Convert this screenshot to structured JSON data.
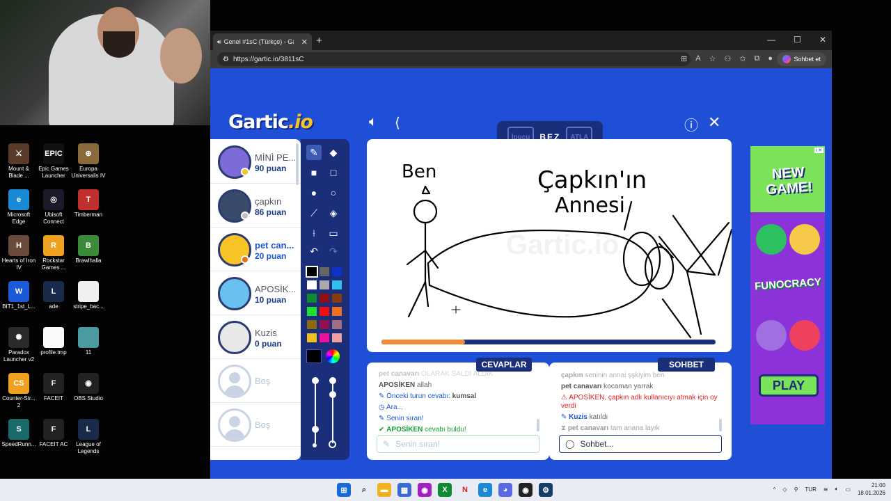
{
  "desktop_icons": [
    {
      "label": "Mount &\nBlade ...",
      "color": "#5a3a2a",
      "glyph": "⚔"
    },
    {
      "label": "Epic Games\nLauncher",
      "color": "#111",
      "glyph": "EPIC"
    },
    {
      "label": "Europa\nUniversalis IV",
      "color": "#8a6a3a",
      "glyph": "⊕"
    },
    {
      "label": "Microsoft\nEdge",
      "color": "#1a8ad6",
      "glyph": "e"
    },
    {
      "label": "Ubisoft\nConnect",
      "color": "#1a1a2a",
      "glyph": "◎"
    },
    {
      "label": "Timberman",
      "color": "#c03030",
      "glyph": "T"
    },
    {
      "label": "Hearts of Iron\nIV",
      "color": "#6a4a3a",
      "glyph": "H"
    },
    {
      "label": "Rockstar\nGames ...",
      "color": "#f0a020",
      "glyph": "R"
    },
    {
      "label": "Brawlhalla",
      "color": "#3a8a3a",
      "glyph": "B"
    },
    {
      "label": "BIT1_1st_L...",
      "color": "#1a5ad6",
      "glyph": "W"
    },
    {
      "label": "ade",
      "color": "#1a2a4a",
      "glyph": "L"
    },
    {
      "label": "stripe_bac...",
      "color": "#f0f0f0",
      "glyph": ""
    },
    {
      "label": "Paradox\nLauncher v2",
      "color": "#2a2a2a",
      "glyph": "✺"
    },
    {
      "label": "profile.tmp",
      "color": "#fafafa",
      "glyph": ""
    },
    {
      "label": "11",
      "color": "#4a9aa0",
      "glyph": ""
    },
    {
      "label": "Counter-Str...\n2",
      "color": "#f0a020",
      "glyph": "CS"
    },
    {
      "label": "FACEIT",
      "color": "#222",
      "glyph": "F"
    },
    {
      "label": "OBS Studio",
      "color": "#222",
      "glyph": "◉"
    },
    {
      "label": "SpeedRunn...",
      "color": "#1a6a6a",
      "glyph": "S"
    },
    {
      "label": "FACEIT AC",
      "color": "#222",
      "glyph": "F"
    },
    {
      "label": "League of\nLegends",
      "color": "#1a2a4a",
      "glyph": "L"
    }
  ],
  "browser": {
    "tab_title": "Genel #1sC (Türkçe) - Gartic.io",
    "url": "https://gartic.io/3811sC",
    "chat_button": "Sohbet et"
  },
  "game": {
    "logo_main": "Gartic",
    "logo_io": ".io",
    "hint_label": "İpucu",
    "word_label": "BEZ",
    "skip_label": "ATLA",
    "players": [
      {
        "name": "MİNİ PE...",
        "points": "90 puan",
        "avatar_color": "#7b6cd9",
        "dot": "#f7c325",
        "mark": "",
        "highlight": false
      },
      {
        "name": "çapkın",
        "points": "86 puan",
        "avatar_color": "#3a4a6a",
        "dot": "#c0c0c0",
        "mark": "",
        "highlight": false
      },
      {
        "name": "pet can...",
        "points": "20 puan",
        "avatar_color": "#f7c325",
        "dot": "#e07020",
        "mark": "✎",
        "highlight": true
      },
      {
        "name": "APOSİK...",
        "points": "10 puan",
        "avatar_color": "#6ac0f0",
        "dot": "",
        "mark": "✔",
        "highlight": false
      },
      {
        "name": "Kuzis",
        "points": "0 puan",
        "avatar_color": "#e8e8e8",
        "dot": "",
        "mark": "",
        "highlight": false
      },
      {
        "name": "Boş",
        "points": "",
        "empty": true
      },
      {
        "name": "Boş",
        "points": "",
        "empty": true
      }
    ],
    "palette": [
      "#000000",
      "#666666",
      "#1030c8",
      "#ffffff",
      "#aaaaaa",
      "#30c0f0",
      "#108a30",
      "#901010",
      "#8a3a10",
      "#20e030",
      "#f01010",
      "#f07020",
      "#8a6a10",
      "#901050",
      "#a07080",
      "#f0c020",
      "#f010a0",
      "#f0a0a0"
    ],
    "drawing_text_1": "Ben",
    "drawing_text_2": "Çapkın'ın",
    "drawing_text_3": "Annesi",
    "progress": 0.25,
    "answers_title": "CEVAPLAR",
    "chat_title": "SOHBET",
    "answers": [
      {
        "user": "pet canavarı",
        "text": "OLARAK SALDI ALDIK",
        "cls": "gray"
      },
      {
        "user": "APOSİKEN",
        "text": "allah",
        "cls": ""
      },
      {
        "icon": "✎",
        "prefix": "Önceki turun cevabı: ",
        "text": "kumsal",
        "cls": "blue"
      },
      {
        "icon": "◷",
        "prefix": "",
        "text": "Ara...",
        "cls": "blue"
      },
      {
        "icon": "✎",
        "prefix": "",
        "text": "Senin sıran!",
        "cls": "blue"
      },
      {
        "icon": "✔",
        "prefix": "APOSİKEN",
        "text": " cevabı buldu!",
        "cls": "green"
      }
    ],
    "chat": [
      {
        "user": "çapkın",
        "text": "seninin annai şşkiyim ben"
      },
      {
        "user": "pet canavarı",
        "text": "kocaman yarrak"
      },
      {
        "alert": "APOSİKEN, çapkın adlı kullanıcıyı atmak için oy verdi"
      },
      {
        "user": "Kuzis",
        "text": "katıldı"
      },
      {
        "user": "pet canavarı",
        "text": "tam anana layık"
      }
    ],
    "answer_placeholder": "Senin sıran!",
    "chat_placeholder": "Sohbet..."
  },
  "ad": {
    "badge": "i ✕",
    "headline": "NEW GAME!",
    "brand": "FUNOCRACY",
    "cta": "PLAY"
  },
  "tray": {
    "lang": "TUR",
    "time": "21:00",
    "date": "18.01.2026"
  }
}
